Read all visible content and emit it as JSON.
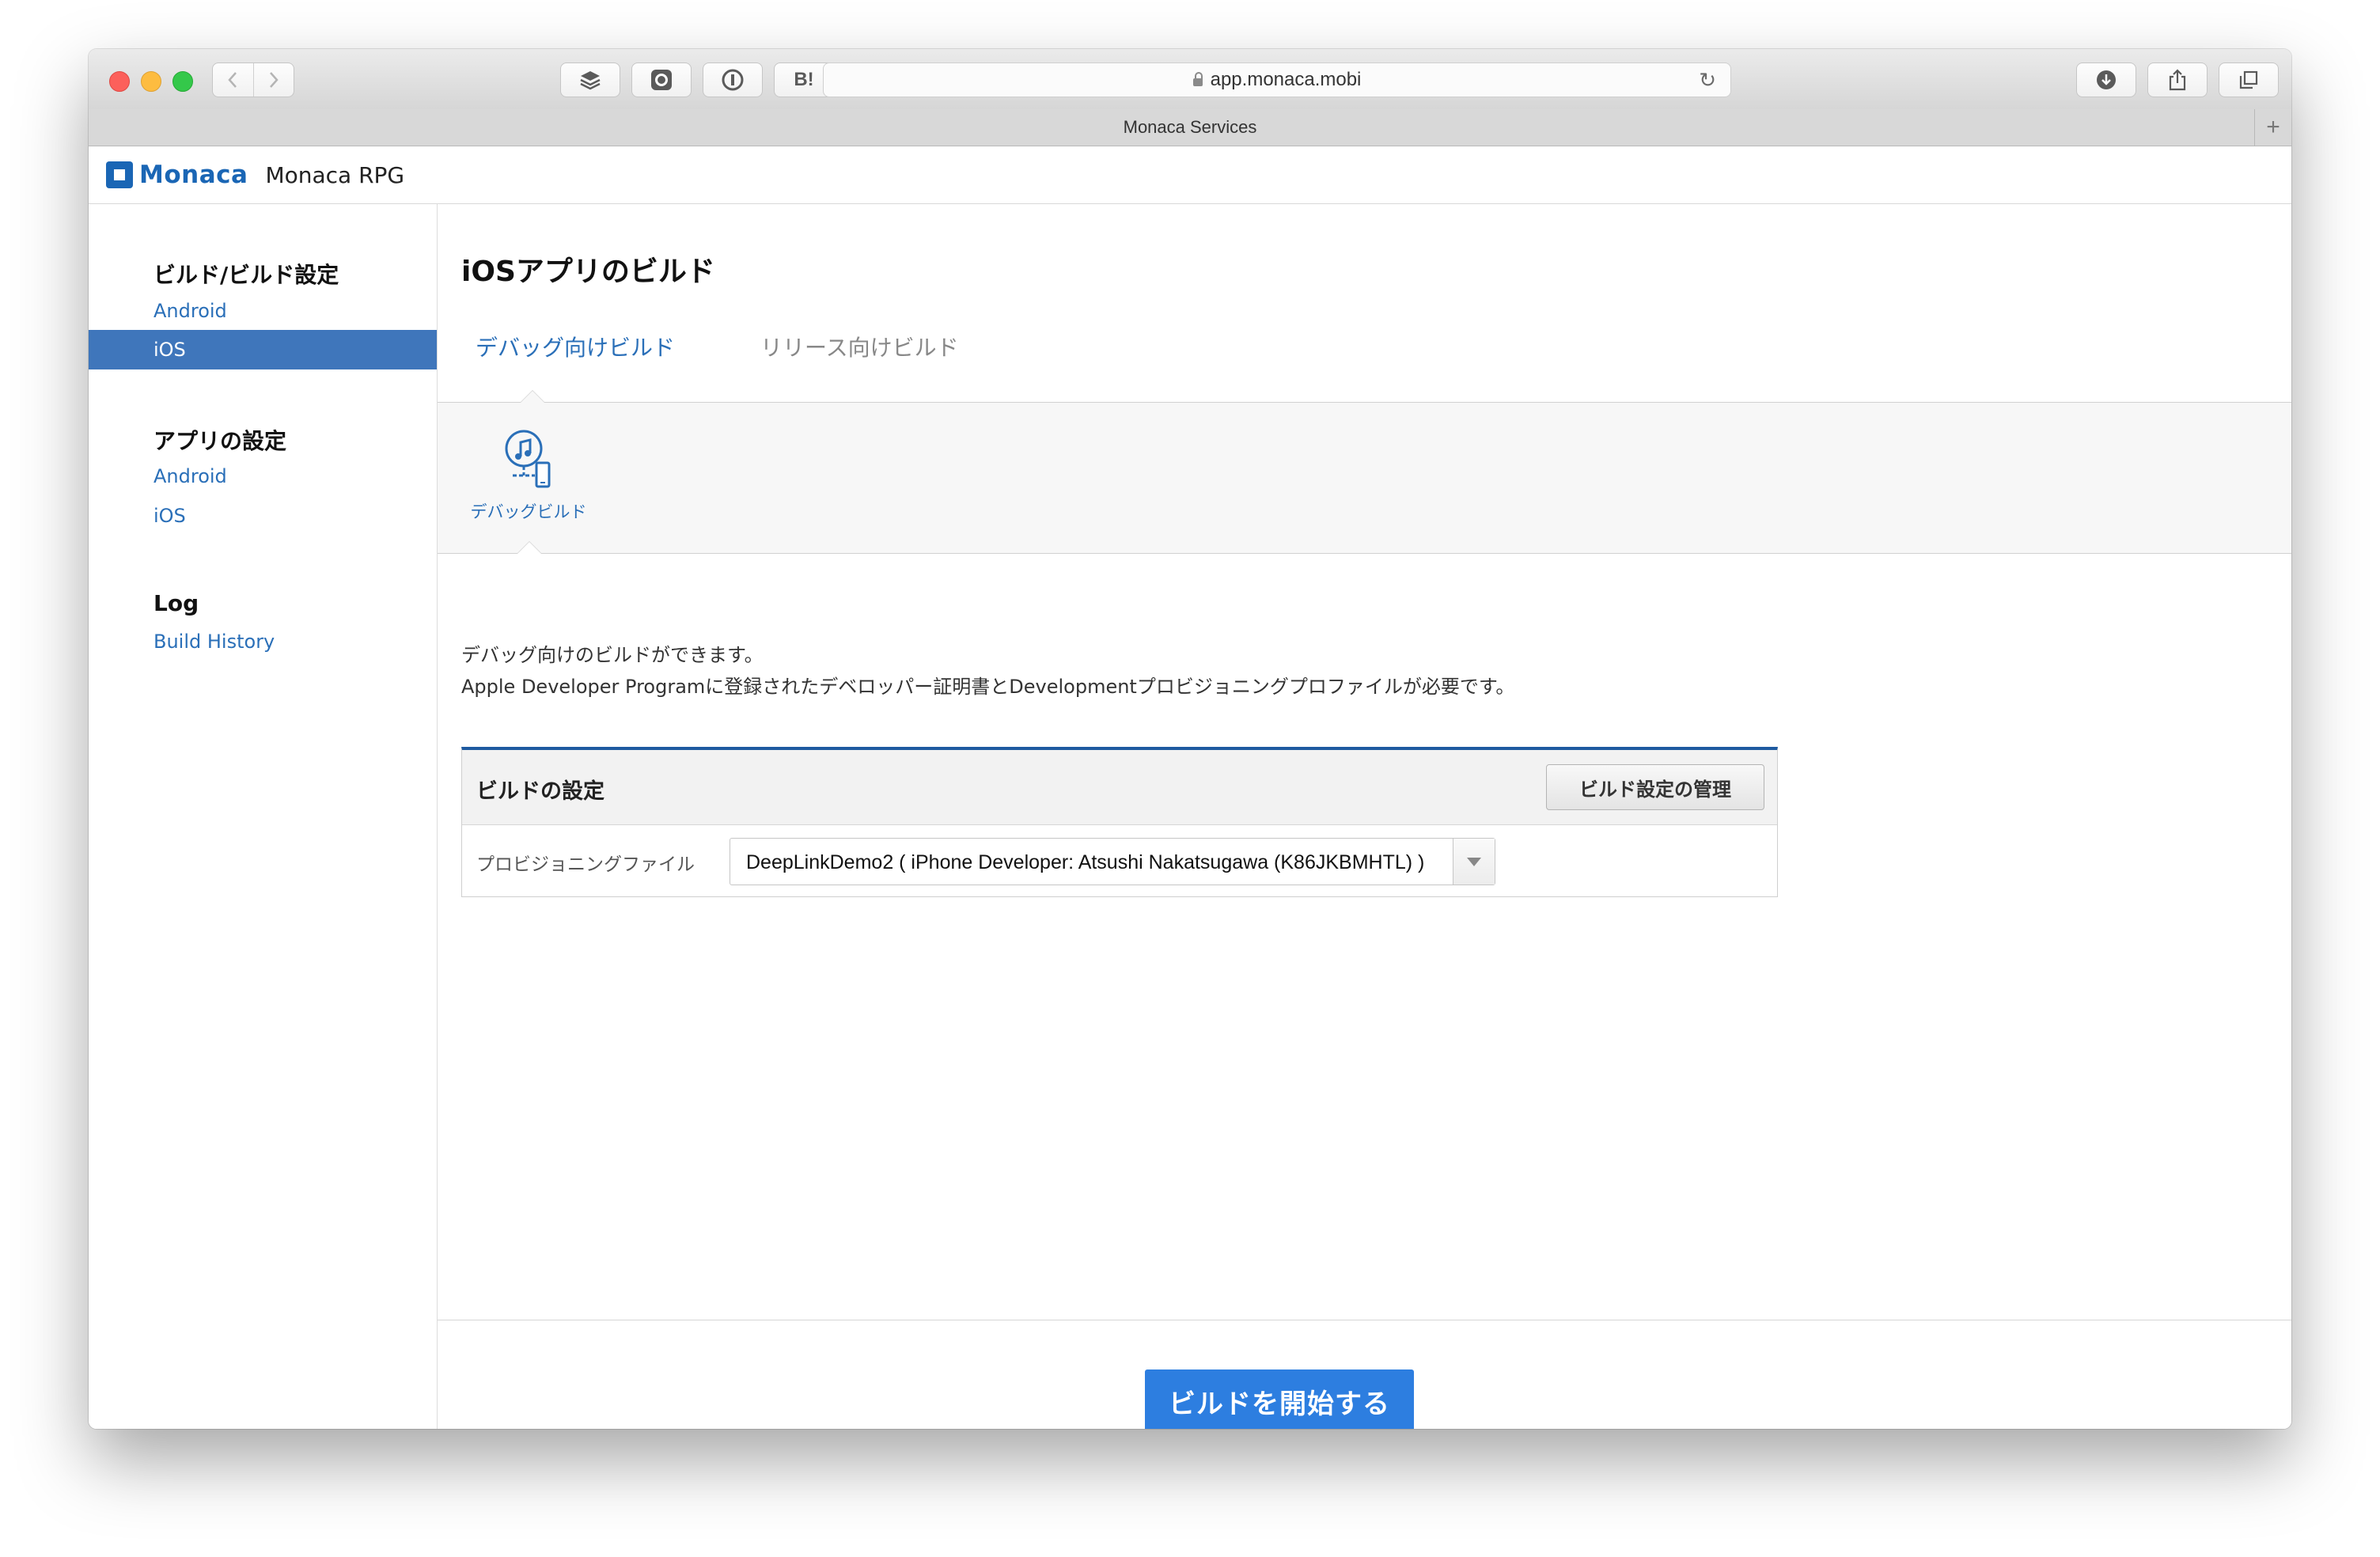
{
  "browser": {
    "url": "app.monaca.mobi",
    "tab_title": "Monaca Services",
    "extension_badges": [
      "B!"
    ]
  },
  "app": {
    "logo_text": "Monaca",
    "project_name": "Monaca RPG"
  },
  "sidebar": {
    "sections": [
      {
        "heading": "ビルド/ビルド設定",
        "items": [
          "Android",
          "iOS"
        ]
      },
      {
        "heading": "アプリの設定",
        "items": [
          "Android",
          "iOS"
        ]
      },
      {
        "heading": "Log",
        "items": [
          "Build History"
        ]
      }
    ],
    "active_item": "iOS"
  },
  "main": {
    "title": "iOSアプリのビルド",
    "tabs": [
      {
        "label": "デバッグ向けビルド",
        "active": true
      },
      {
        "label": "リリース向けビルド",
        "active": false
      }
    ],
    "sub_item": {
      "label": "デバッグビルド",
      "icon": "itunes-device-icon"
    },
    "description": [
      "デバッグ向けのビルドができます。",
      "Apple Developer Programに登録されたデベロッパー証明書とDevelopmentプロビジョニングプロファイルが必要です。"
    ],
    "panel": {
      "title": "ビルドの設定",
      "manage_button": "ビルド設定の管理",
      "field_label": "プロビジョニングファイル",
      "selected_profile": "DeepLinkDemo2 ( iPhone Developer: Atsushi Nakatsugawa (K86JKBMHTL) )"
    },
    "start_button": "ビルドを開始する"
  },
  "colors": {
    "accent": "#2a6fb8",
    "sidebar_active": "#3f76bb",
    "primary_button": "#2d7ee0",
    "panel_border_top": "#1e5aa0"
  }
}
